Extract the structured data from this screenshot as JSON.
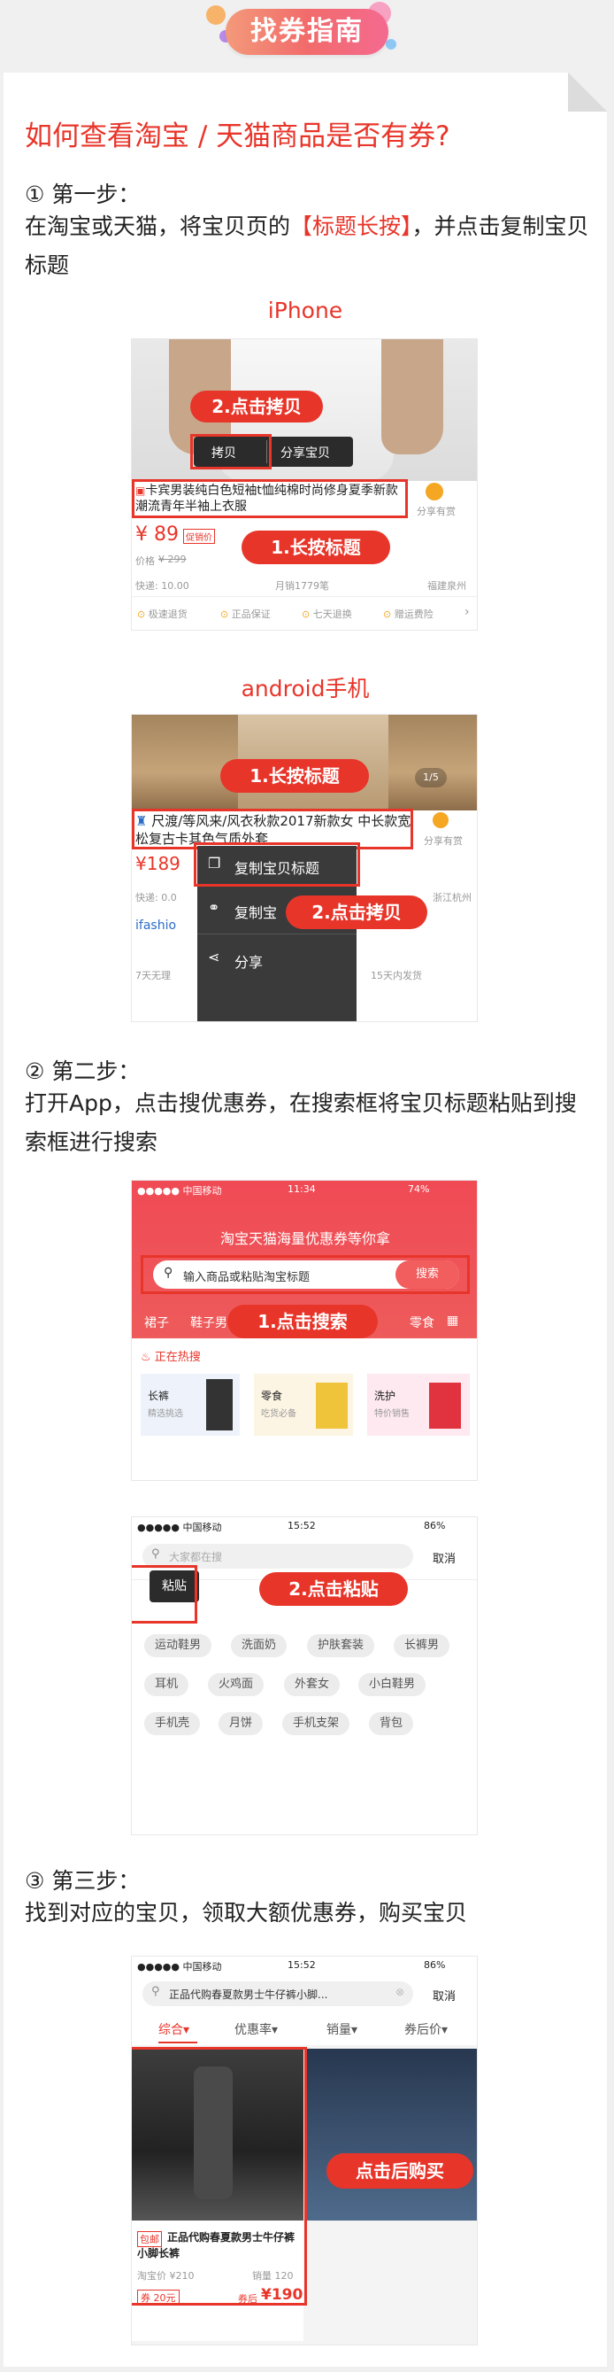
{
  "header": {
    "title": "找券指南"
  },
  "question": "如何查看淘宝 / 天猫商品是否有券?",
  "step1": {
    "title": "① 第一步：",
    "text_before": "在淘宝或天猫，将宝贝页的",
    "text_highlight": "【标题长按】",
    "text_after": "，并点击复制宝贝标题",
    "iphone_caption": "iPhone",
    "android_caption": "android手机"
  },
  "iphone": {
    "label_copy": "2.点击拷贝",
    "label_longpress": "1.长按标题",
    "popup_copy": "拷贝",
    "popup_share": "分享宝贝",
    "product_title": "卡宾男装纯白色短袖t恤纯棉时尚修身夏季新款潮流青年半袖上衣服",
    "share_label": "分享有赏",
    "price": "¥ 89",
    "price_badge": "促销价",
    "orig_price_label": "价格",
    "orig_price": "¥ 299",
    "delivery": "快递: 10.00",
    "monthly_sales": "月销1779笔",
    "location": "福建泉州",
    "service_1": "极速退货",
    "service_2": "正品保证",
    "service_3": "七天退换",
    "service_4": "赠运费险"
  },
  "android": {
    "label_longpress": "1.长按标题",
    "label_copy": "2.点击拷贝",
    "product_title": "尺渡/等风来/风衣秋款2017新款女 中长款宽松复古卡其色气质外套",
    "share_label": "分享有赏",
    "price": "¥189",
    "delivery": "快递: 0.0",
    "location": "浙江杭州",
    "brand": "ifashio",
    "service_left": "7天无理",
    "service_right": "15天内发货",
    "page_indicator": "1/5",
    "menu_copy_title": "复制宝贝标题",
    "menu_copy_link": "复制宝",
    "menu_share": "分享"
  },
  "step2": {
    "title": "② 第二步：",
    "text": "打开App，点击搜优惠券，在搜索框将宝贝标题粘贴到搜索框进行搜索"
  },
  "app_home": {
    "carrier": "●●●●● 中国移动",
    "time": "11:34",
    "battery": "74%",
    "slogan": "淘宝天猫海量优惠券等你拿",
    "search_placeholder": "输入商品或粘贴淘宝标题",
    "search_button": "搜索",
    "label_search": "1.点击搜索",
    "categories": [
      "裙子",
      "鞋子男",
      "零食"
    ],
    "hot_title": "正在热搜",
    "hot_items": [
      {
        "name": "长裤",
        "sub": "精选挑选"
      },
      {
        "name": "零食",
        "sub": "吃货必备"
      },
      {
        "name": "洗护",
        "sub": "特价销售"
      }
    ]
  },
  "app_search": {
    "carrier": "●●●●● 中国移动",
    "time": "15:52",
    "battery": "86%",
    "placeholder": "大家都在搜",
    "cancel": "取消",
    "paste": "粘贴",
    "label_paste": "2.点击粘贴",
    "tags": [
      "运动鞋男",
      "洗面奶",
      "护肤套装",
      "长裤男",
      "耳机",
      "火鸡面",
      "外套女",
      "小白鞋男",
      "手机壳",
      "月饼",
      "手机支架",
      "背包"
    ]
  },
  "step3": {
    "title": "③ 第三步：",
    "text": "找到对应的宝贝，领取大额优惠券，购买宝贝"
  },
  "app_result": {
    "carrier": "●●●●● 中国移动",
    "time": "15:52",
    "battery": "86%",
    "query": "正品代购春夏款男士牛仔裤小脚...",
    "cancel": "取消",
    "sort_tabs": [
      "综合",
      "优惠率",
      "销量",
      "券后价"
    ],
    "badge": "包邮",
    "product_title": "正品代购春夏款男士牛仔裤小脚长裤",
    "taobao_price": "淘宝价 ¥210",
    "sales": "销量 120",
    "coupon": "券 20元",
    "after_coupon_label": "券后",
    "after_coupon_price": "¥190",
    "label_buy": "点击后购买"
  }
}
